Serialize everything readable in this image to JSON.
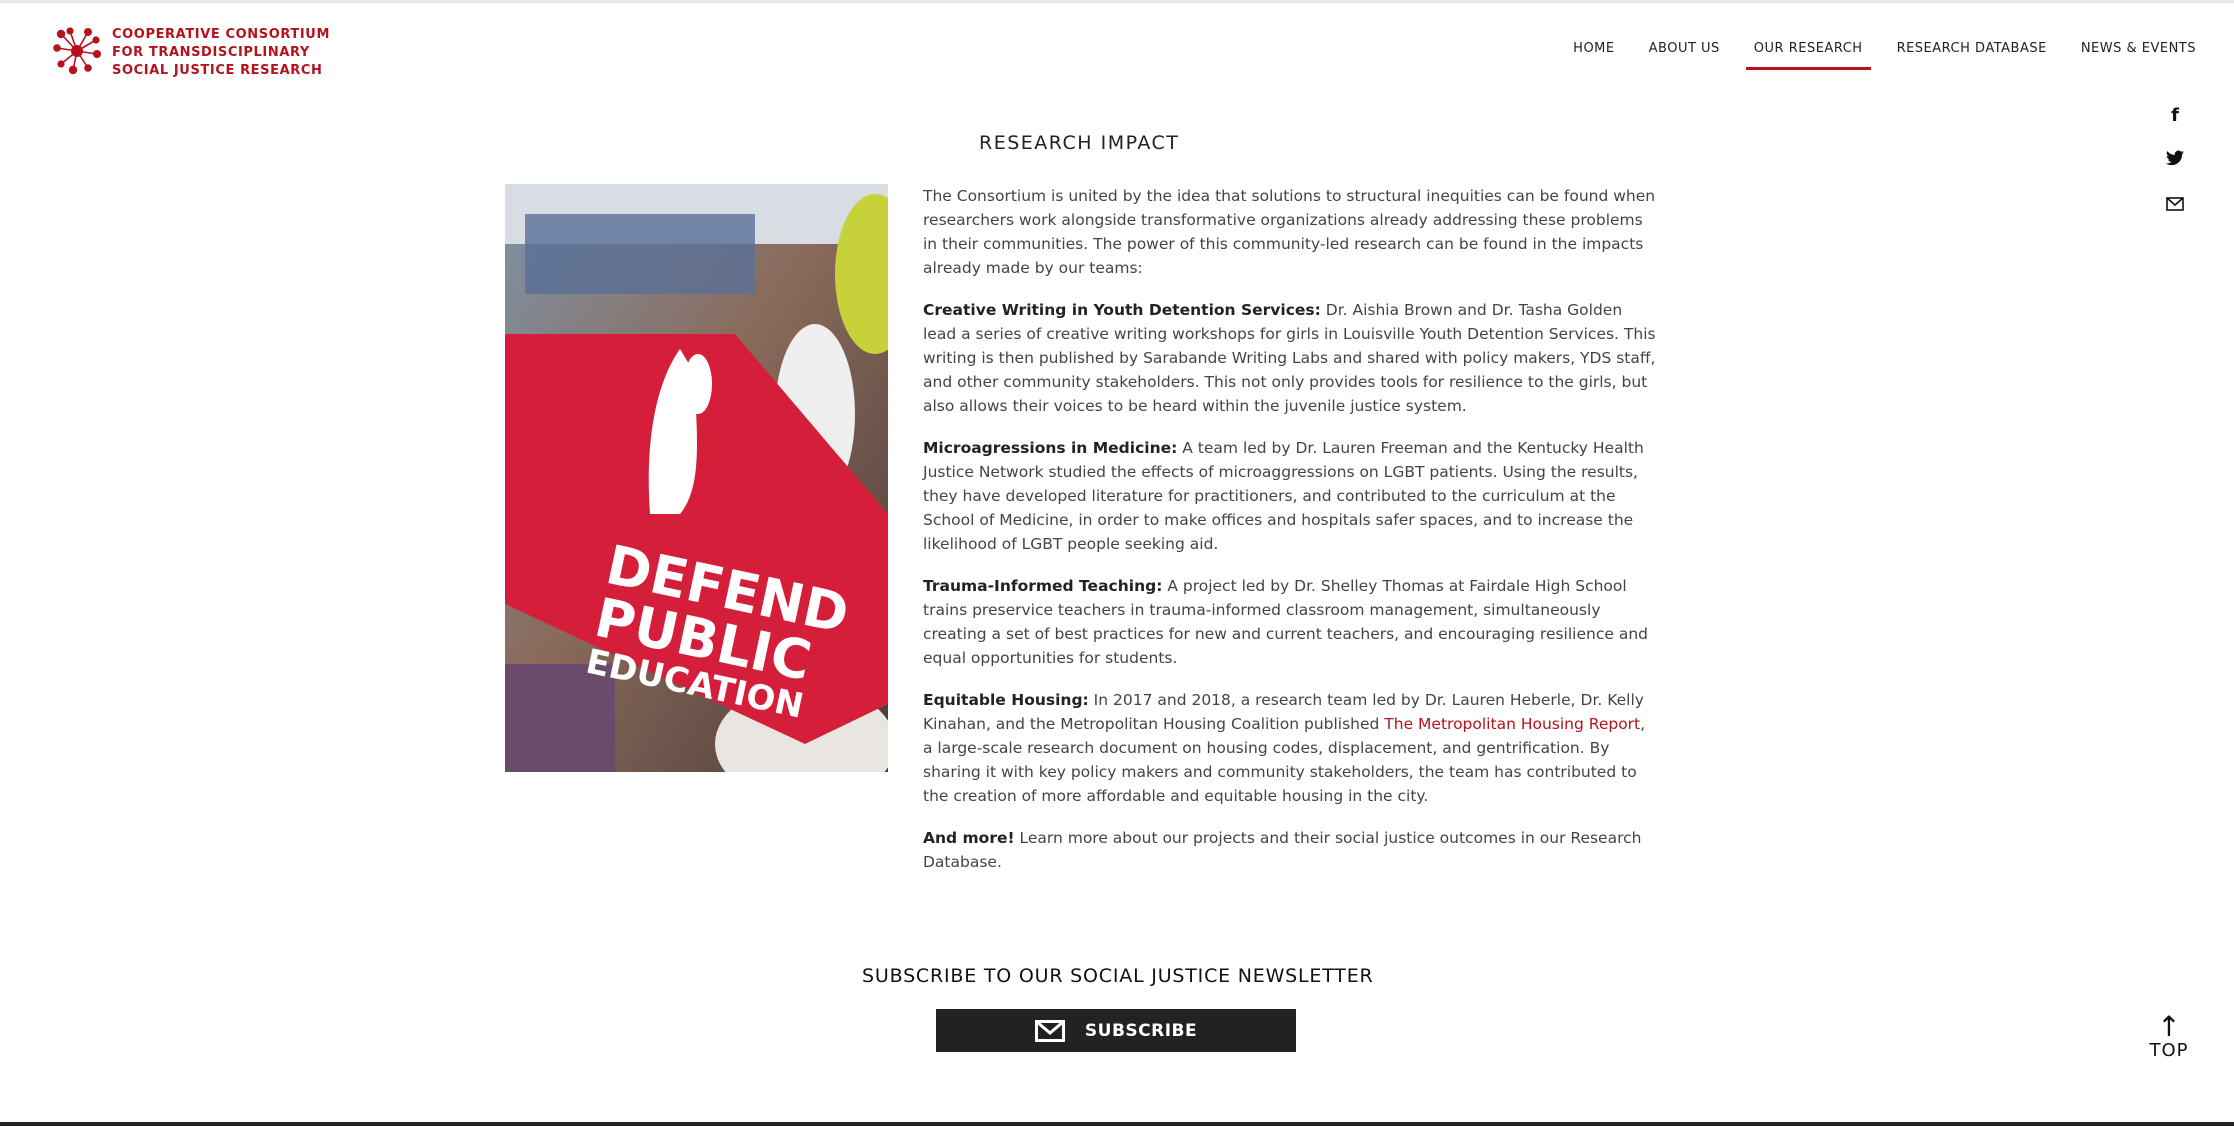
{
  "brand": {
    "line1": "COOPERATIVE CONSORTIUM",
    "line2": "FOR TRANSDISCIPLINARY",
    "line3": "SOCIAL JUSTICE RESEARCH",
    "color": "#b5121b"
  },
  "nav": {
    "items": [
      {
        "label": "HOME"
      },
      {
        "label": "ABOUT US"
      },
      {
        "label": "OUR RESEARCH",
        "active": true
      },
      {
        "label": "RESEARCH DATABASE"
      },
      {
        "label": "NEWS & EVENTS"
      }
    ]
  },
  "social": {
    "facebook": "f",
    "twitter": "twitter-icon",
    "email": "mail-icon"
  },
  "page": {
    "title": "RESEARCH IMPACT"
  },
  "hero": {
    "sign_line1": "DEFEND",
    "sign_line2": "PUBLIC",
    "sign_line3": "EDUCATION"
  },
  "article": {
    "intro": "The Consortium is united by the idea that solutions to structural inequities can be found when researchers work alongside transformative organizations already addressing these problems in their communities. The power of this community-led research can be found in the impacts already made by our teams:",
    "items": [
      {
        "label": "Creative Writing in Youth Detention Services:",
        "text": " Dr. Aishia Brown and Dr. Tasha Golden lead a series of creative writing workshops for girls in Louisville Youth Detention Services. This writing is then published by Sarabande Writing Labs and shared with policy makers, YDS staff, and other community stakeholders. This not only provides tools for resilience to the girls, but also allows their voices to be heard within the juvenile justice system."
      },
      {
        "label": "Microagressions in Medicine:",
        "text": " A team led by Dr. Lauren Freeman and the Kentucky Health Justice Network studied the effects of microaggressions on LGBT patients. Using the results, they have developed literature for practitioners, and contributed to the curriculum at the School of Medicine, in order to make offices and hospitals safer spaces, and to increase the likelihood of LGBT people seeking aid."
      },
      {
        "label": "Trauma-Informed Teaching:",
        "text": " A project led by Dr. Shelley Thomas at Fairdale High School trains preservice teachers in trauma-informed classroom management, simultaneously creating a set of best practices for new and current teachers, and encouraging resilience and equal opportunities for students."
      }
    ],
    "housing": {
      "label": "Equitable Housing:",
      "text_before": " In 2017 and 2018, a research team led by Dr. Lauren Heberle, Dr. Kelly Kinahan, and the Metropolitan Housing Coalition published ",
      "link": "The Metropolitan Housing Report",
      "text_after": ", a large-scale research document on housing codes, displacement, and gentrification. By sharing it with key policy makers and community stakeholders, the team has contributed to the creation of more affordable and equitable housing in the city."
    },
    "more": {
      "label": "And more!",
      "text": " Learn more about our projects and their social justice outcomes in our Research Database."
    }
  },
  "newsletter": {
    "title": "SUBSCRIBE TO OUR SOCIAL JUSTICE NEWSLETTER",
    "button": "SUBSCRIBE"
  },
  "back_to_top": {
    "arrow": "↑",
    "label": "TOP"
  }
}
